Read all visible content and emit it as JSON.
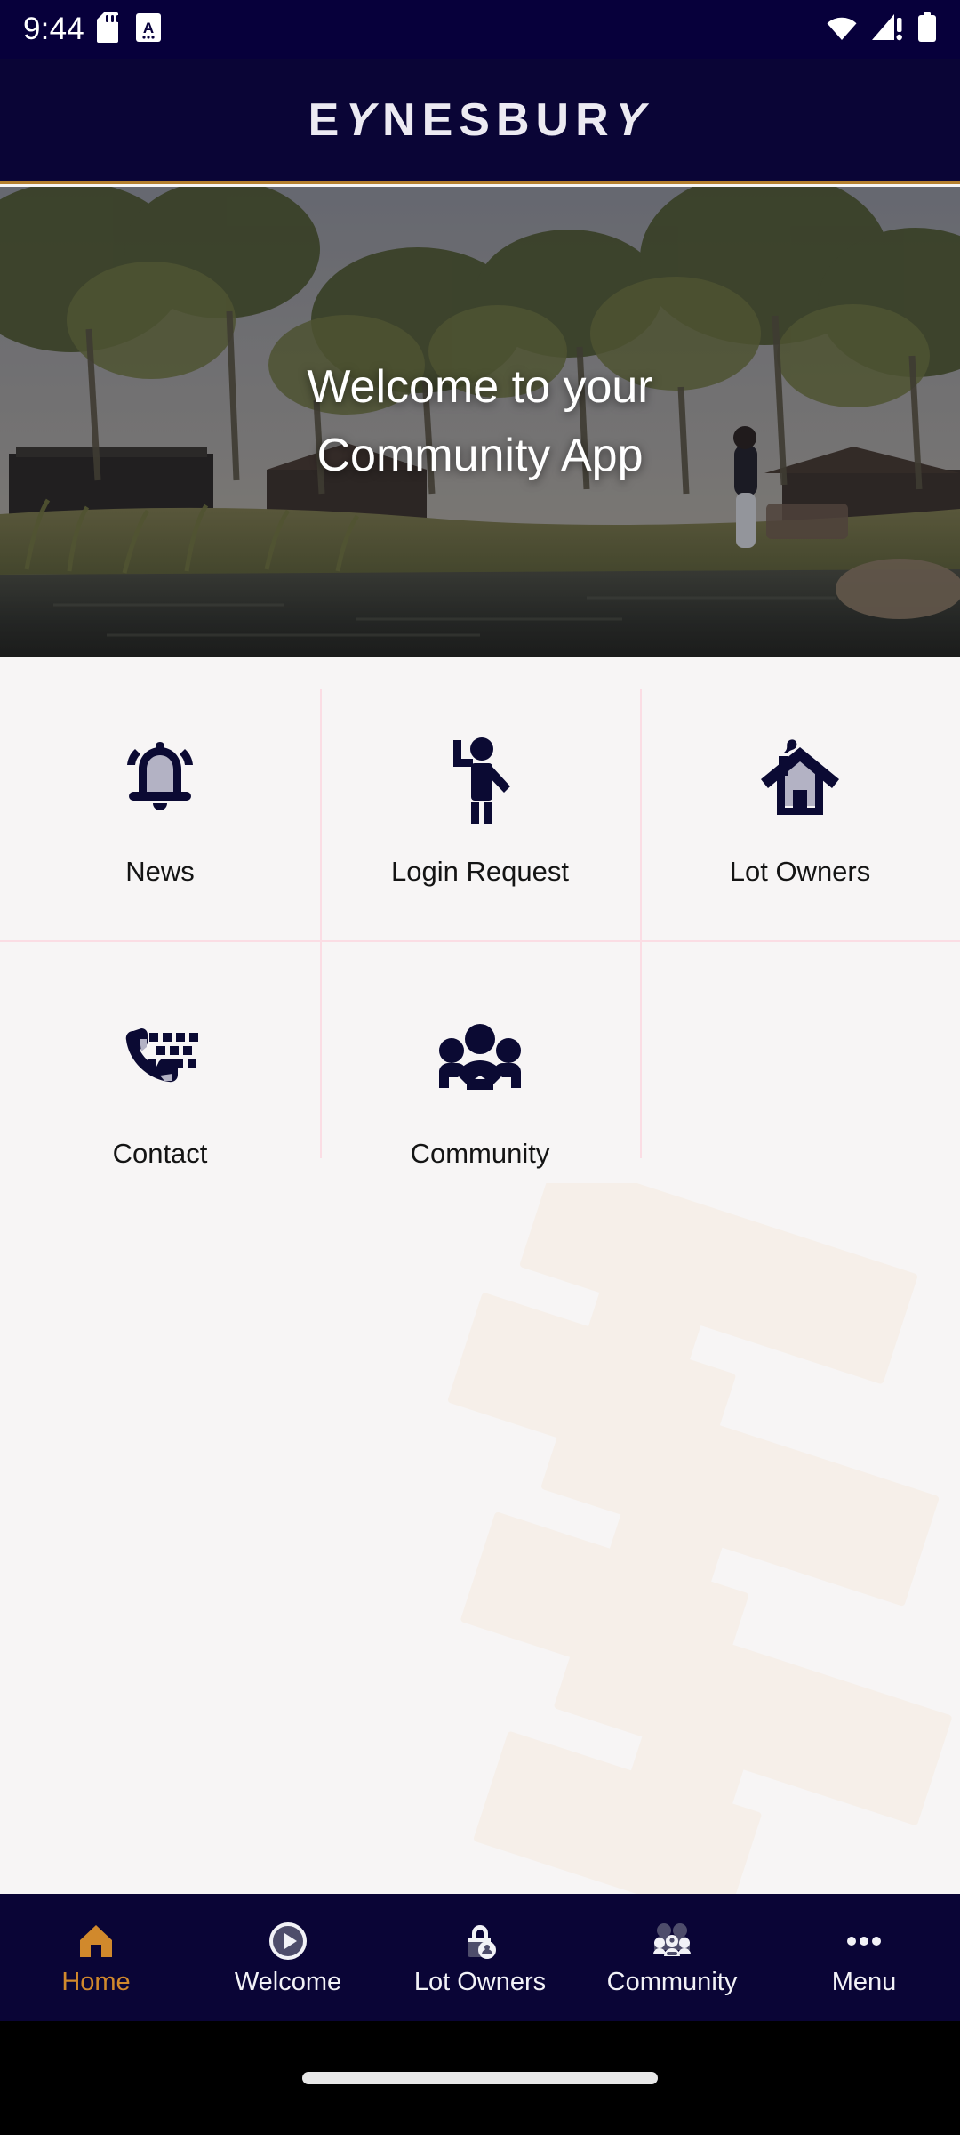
{
  "status_bar": {
    "clock": "9:44",
    "left_icons": [
      "sd-card-icon",
      "app-badge-a-icon"
    ],
    "right_icons": [
      "wifi-icon",
      "cellular-signal-alert-icon",
      "battery-icon"
    ]
  },
  "header": {
    "brand": "EYNESBURY",
    "accent_color": "#b5802f",
    "background_color": "#0a0536"
  },
  "hero": {
    "line1": "Welcome to your",
    "line2": "Community App",
    "image_alt": "wetland lake with eucalyptus trees, houses and a person walking"
  },
  "tiles": [
    {
      "label": "News",
      "icon": "bell-icon"
    },
    {
      "label": "Login Request",
      "icon": "waving-person-icon"
    },
    {
      "label": "Lot Owners",
      "icon": "house-icon"
    },
    {
      "label": "Contact",
      "icon": "phone-dialpad-icon"
    },
    {
      "label": "Community",
      "icon": "people-group-icon"
    }
  ],
  "bottom_nav": {
    "active_color": "#d1892c",
    "inactive_color": "#f2f2f7",
    "items": [
      {
        "label": "Home",
        "icon": "home-icon",
        "active": true
      },
      {
        "label": "Welcome",
        "icon": "play-circle-icon",
        "active": false
      },
      {
        "label": "Lot Owners",
        "icon": "lock-person-icon",
        "active": false
      },
      {
        "label": "Community",
        "icon": "people-group-icon",
        "active": false
      },
      {
        "label": "Menu",
        "icon": "more-horizontal-icon",
        "active": false
      }
    ]
  },
  "colors": {
    "page_background": "#f7f5f5",
    "divider": "#fbdde4",
    "icon_dark": "#0b0a33",
    "icon_light": "#b3b2c4",
    "watermark": "#f6efe9"
  }
}
